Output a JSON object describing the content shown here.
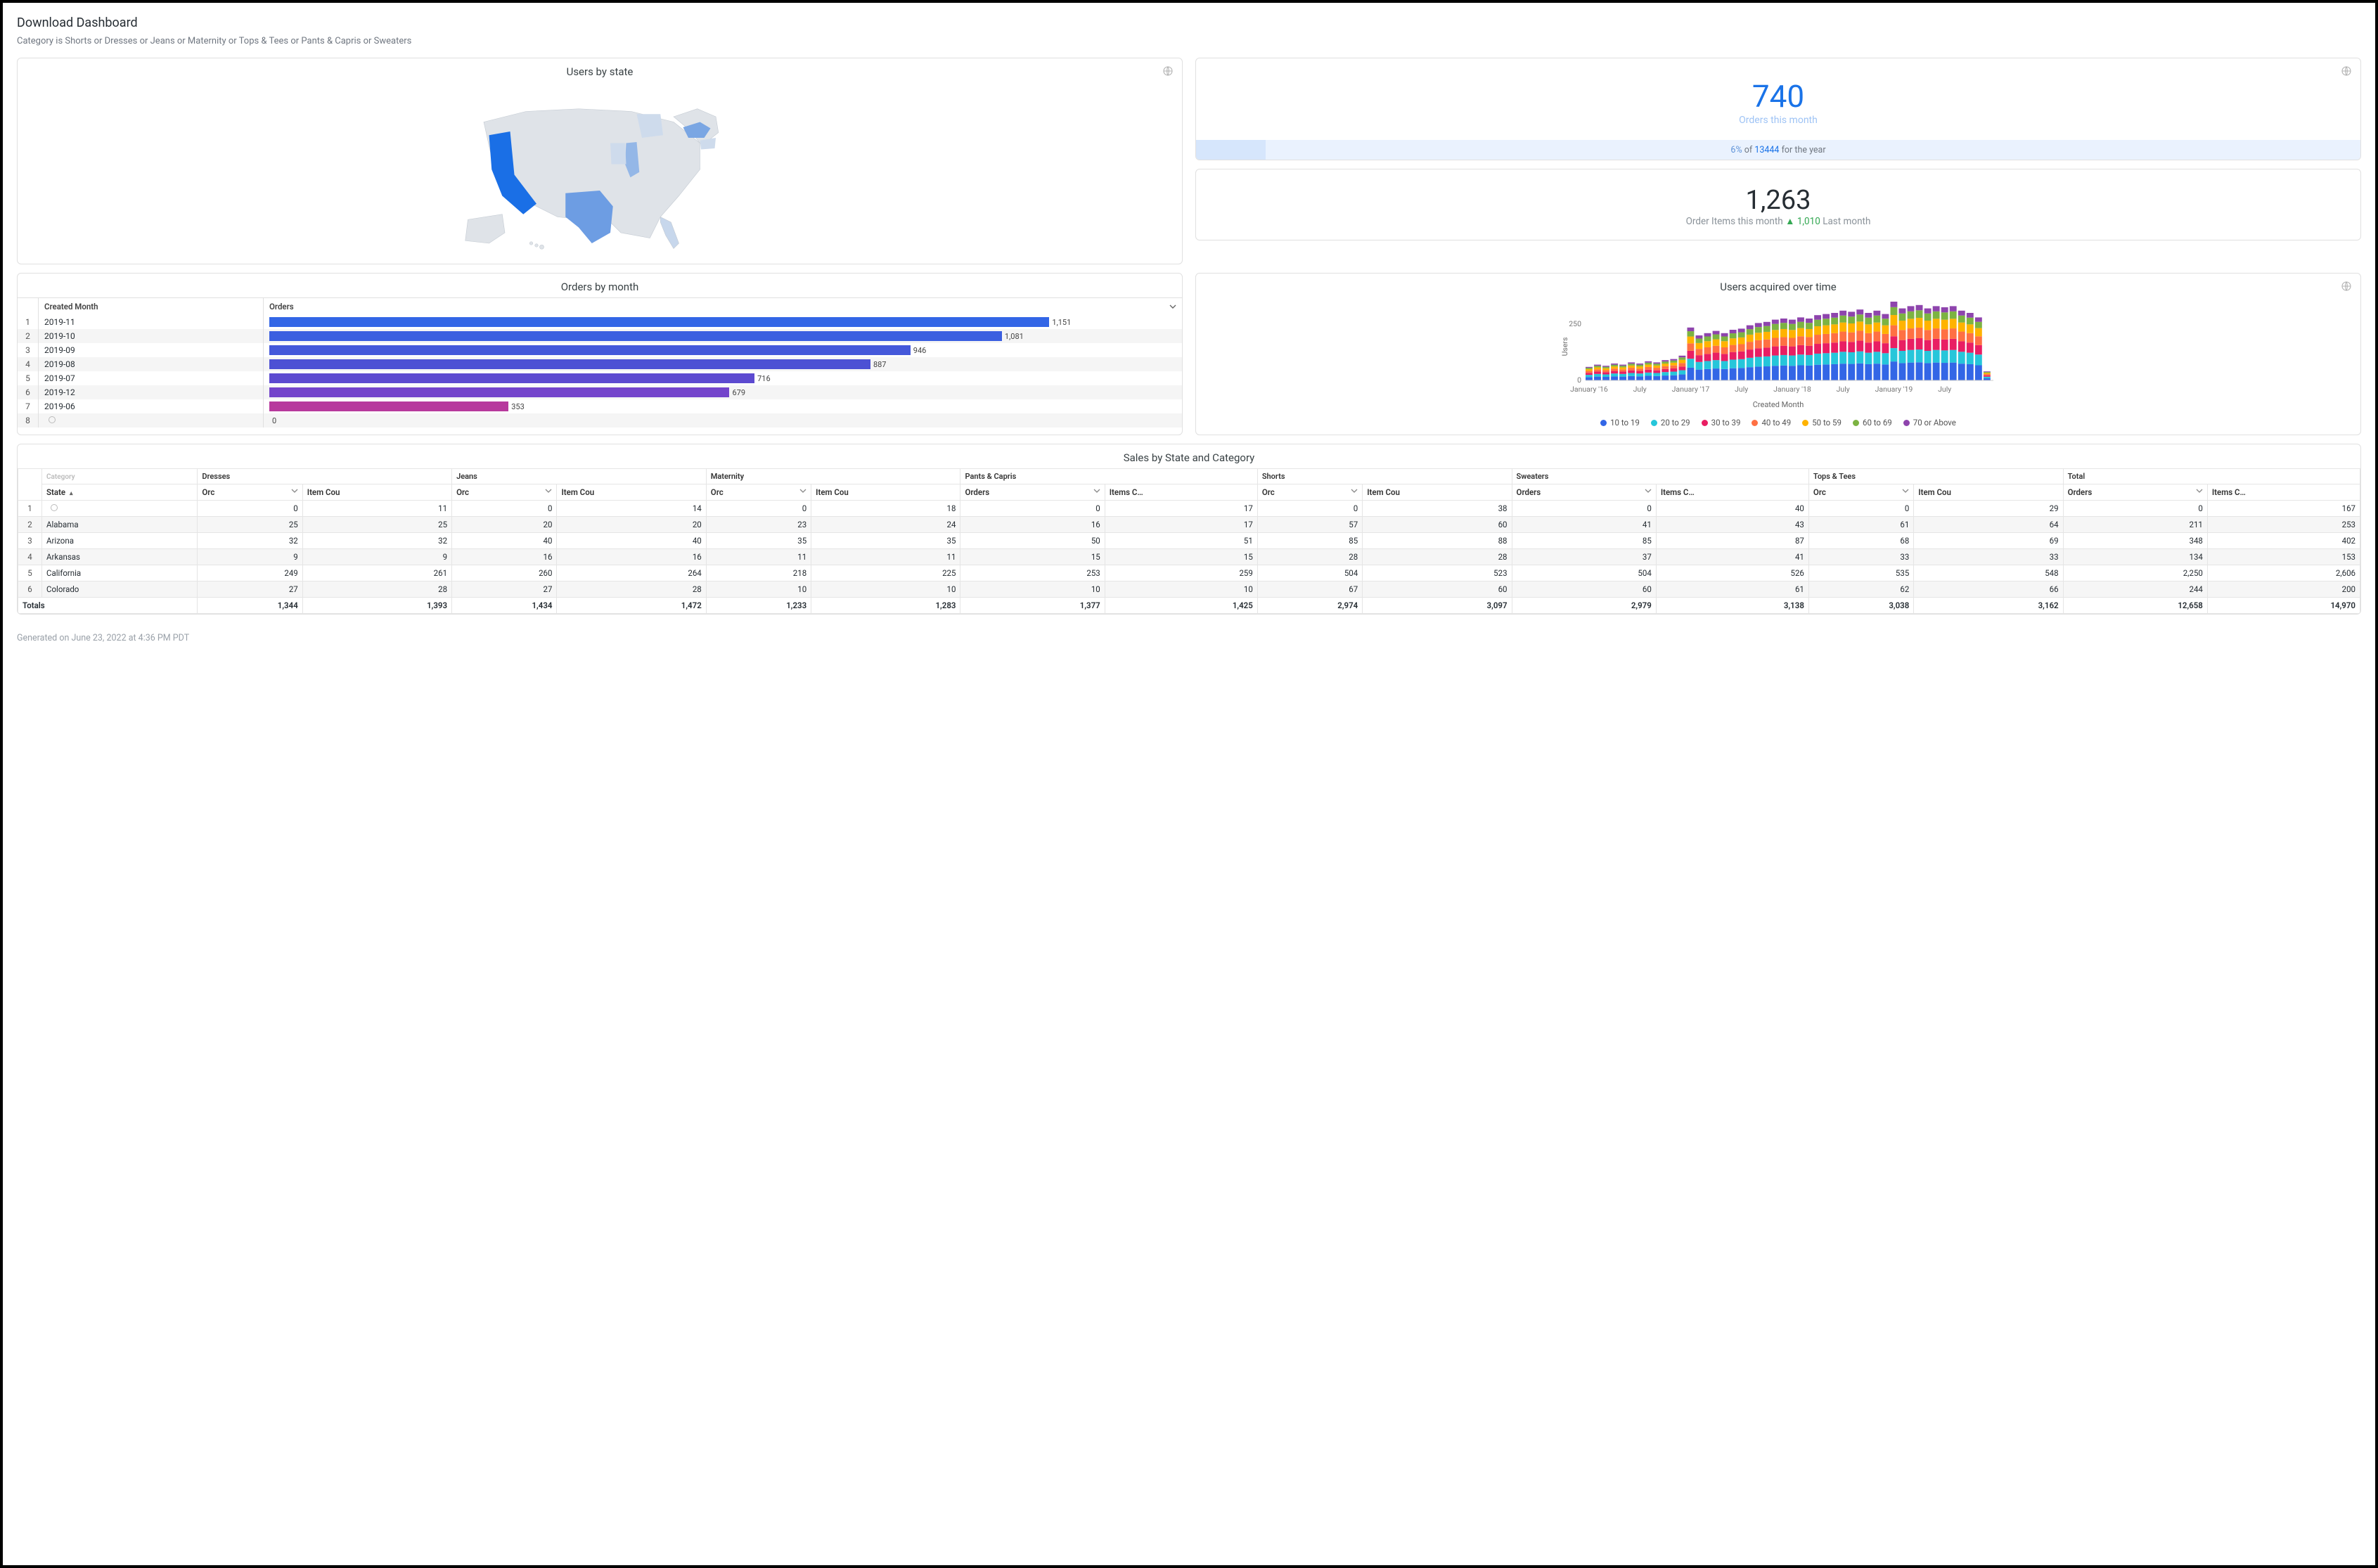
{
  "header": {
    "title": "Download Dashboard",
    "filter": "Category is Shorts or Dresses or Jeans or Maternity or Tops & Tees or Pants & Capris or Sweaters"
  },
  "map": {
    "title": "Users by state",
    "highlighted_states": [
      "California",
      "Texas",
      "New York",
      "Illinois",
      "Florida"
    ]
  },
  "kpi_orders": {
    "value": "740",
    "label": "Orders this month",
    "bar_pct": 6,
    "bar_total": "13444",
    "bar_suffix": "for the year",
    "bar_prefix_of": "of"
  },
  "kpi_items": {
    "value": "1,263",
    "label_prefix": "Order Items this month",
    "delta": "1,010",
    "label_suffix": "Last month"
  },
  "orders_by_month": {
    "title": "Orders by month",
    "col_month": "Created Month",
    "col_orders": "Orders",
    "max": 1151,
    "rows": [
      {
        "idx": 1,
        "month": "2019-11",
        "orders": 1151,
        "color": "#3366e6"
      },
      {
        "idx": 2,
        "month": "2019-10",
        "orders": 1081,
        "color": "#3b5fe0"
      },
      {
        "idx": 3,
        "month": "2019-09",
        "orders": 946,
        "color": "#4458da"
      },
      {
        "idx": 4,
        "month": "2019-08",
        "orders": 887,
        "color": "#4d51d4"
      },
      {
        "idx": 5,
        "month": "2019-07",
        "orders": 716,
        "color": "#5c4ad0"
      },
      {
        "idx": 6,
        "month": "2019-12",
        "orders": 679,
        "color": "#7344cb"
      },
      {
        "idx": 7,
        "month": "2019-06",
        "orders": 353,
        "color": "#b7399d"
      },
      {
        "idx": 8,
        "month": "",
        "orders": 0,
        "color": "#e8368f",
        "empty": true
      }
    ]
  },
  "chart_data": {
    "type": "bar",
    "title": "Users acquired over time",
    "xlabel": "Created Month",
    "ylabel": "Users",
    "ylim": [
      0,
      350
    ],
    "yticks": [
      0,
      250
    ],
    "x_tick_labels": [
      "January '16",
      "July",
      "January '17",
      "July",
      "January '18",
      "July",
      "January '19",
      "July"
    ],
    "legend": [
      {
        "name": "10 to 19",
        "color": "#3366e6"
      },
      {
        "name": "20 to 29",
        "color": "#26c6da"
      },
      {
        "name": "30 to 39",
        "color": "#e91e63"
      },
      {
        "name": "40 to 49",
        "color": "#ff7043"
      },
      {
        "name": "50 to 59",
        "color": "#ffb300"
      },
      {
        "name": "60 to 69",
        "color": "#7cb342"
      },
      {
        "name": "70 or Above",
        "color": "#8e44ad"
      }
    ],
    "categories_count": 48,
    "series_totals_approx": [
      60,
      70,
      65,
      75,
      70,
      80,
      75,
      85,
      80,
      90,
      95,
      110,
      235,
      200,
      210,
      220,
      210,
      225,
      230,
      245,
      255,
      260,
      270,
      275,
      270,
      280,
      275,
      290,
      295,
      300,
      310,
      305,
      315,
      300,
      310,
      295,
      350,
      320,
      330,
      335,
      320,
      330,
      325,
      330,
      310,
      300,
      280,
      40
    ]
  },
  "sales": {
    "title": "Sales by State and Category",
    "category_label": "Category",
    "state_label": "State",
    "orders_label": "Orders",
    "items_label": "Items Count",
    "orders_short": "Orc",
    "items_short": "Item Cou",
    "total_label": "Total",
    "totals_label": "Totals",
    "categories": [
      "Dresses",
      "Jeans",
      "Maternity",
      "Pants & Capris",
      "Shorts",
      "Sweaters",
      "Tops & Tees",
      "Total"
    ],
    "rows": [
      {
        "idx": 1,
        "state": "",
        "empty": true,
        "vals": [
          0,
          11,
          0,
          14,
          0,
          18,
          0,
          17,
          0,
          38,
          0,
          40,
          0,
          29,
          0,
          167
        ]
      },
      {
        "idx": 2,
        "state": "Alabama",
        "vals": [
          25,
          25,
          20,
          20,
          23,
          24,
          16,
          17,
          57,
          60,
          41,
          43,
          61,
          64,
          211,
          253
        ]
      },
      {
        "idx": 3,
        "state": "Arizona",
        "vals": [
          32,
          32,
          40,
          40,
          35,
          35,
          50,
          51,
          85,
          88,
          85,
          87,
          68,
          69,
          348,
          402
        ]
      },
      {
        "idx": 4,
        "state": "Arkansas",
        "vals": [
          9,
          9,
          16,
          16,
          11,
          11,
          15,
          15,
          28,
          28,
          37,
          41,
          33,
          33,
          134,
          153
        ]
      },
      {
        "idx": 5,
        "state": "California",
        "vals": [
          249,
          261,
          260,
          264,
          218,
          225,
          253,
          259,
          504,
          523,
          504,
          526,
          535,
          548,
          2250,
          2606
        ]
      },
      {
        "idx": 6,
        "state": "Colorado",
        "vals": [
          27,
          28,
          27,
          28,
          10,
          10,
          10,
          10,
          67,
          60,
          60,
          61,
          62,
          66,
          244,
          200
        ]
      }
    ],
    "totals": [
      1344,
      1393,
      1434,
      1472,
      1233,
      1283,
      1377,
      1425,
      2974,
      3097,
      2979,
      3138,
      3038,
      3162,
      12658,
      14970
    ]
  },
  "footer": {
    "text": "Generated on June 23, 2022 at 4:36 PM PDT"
  }
}
